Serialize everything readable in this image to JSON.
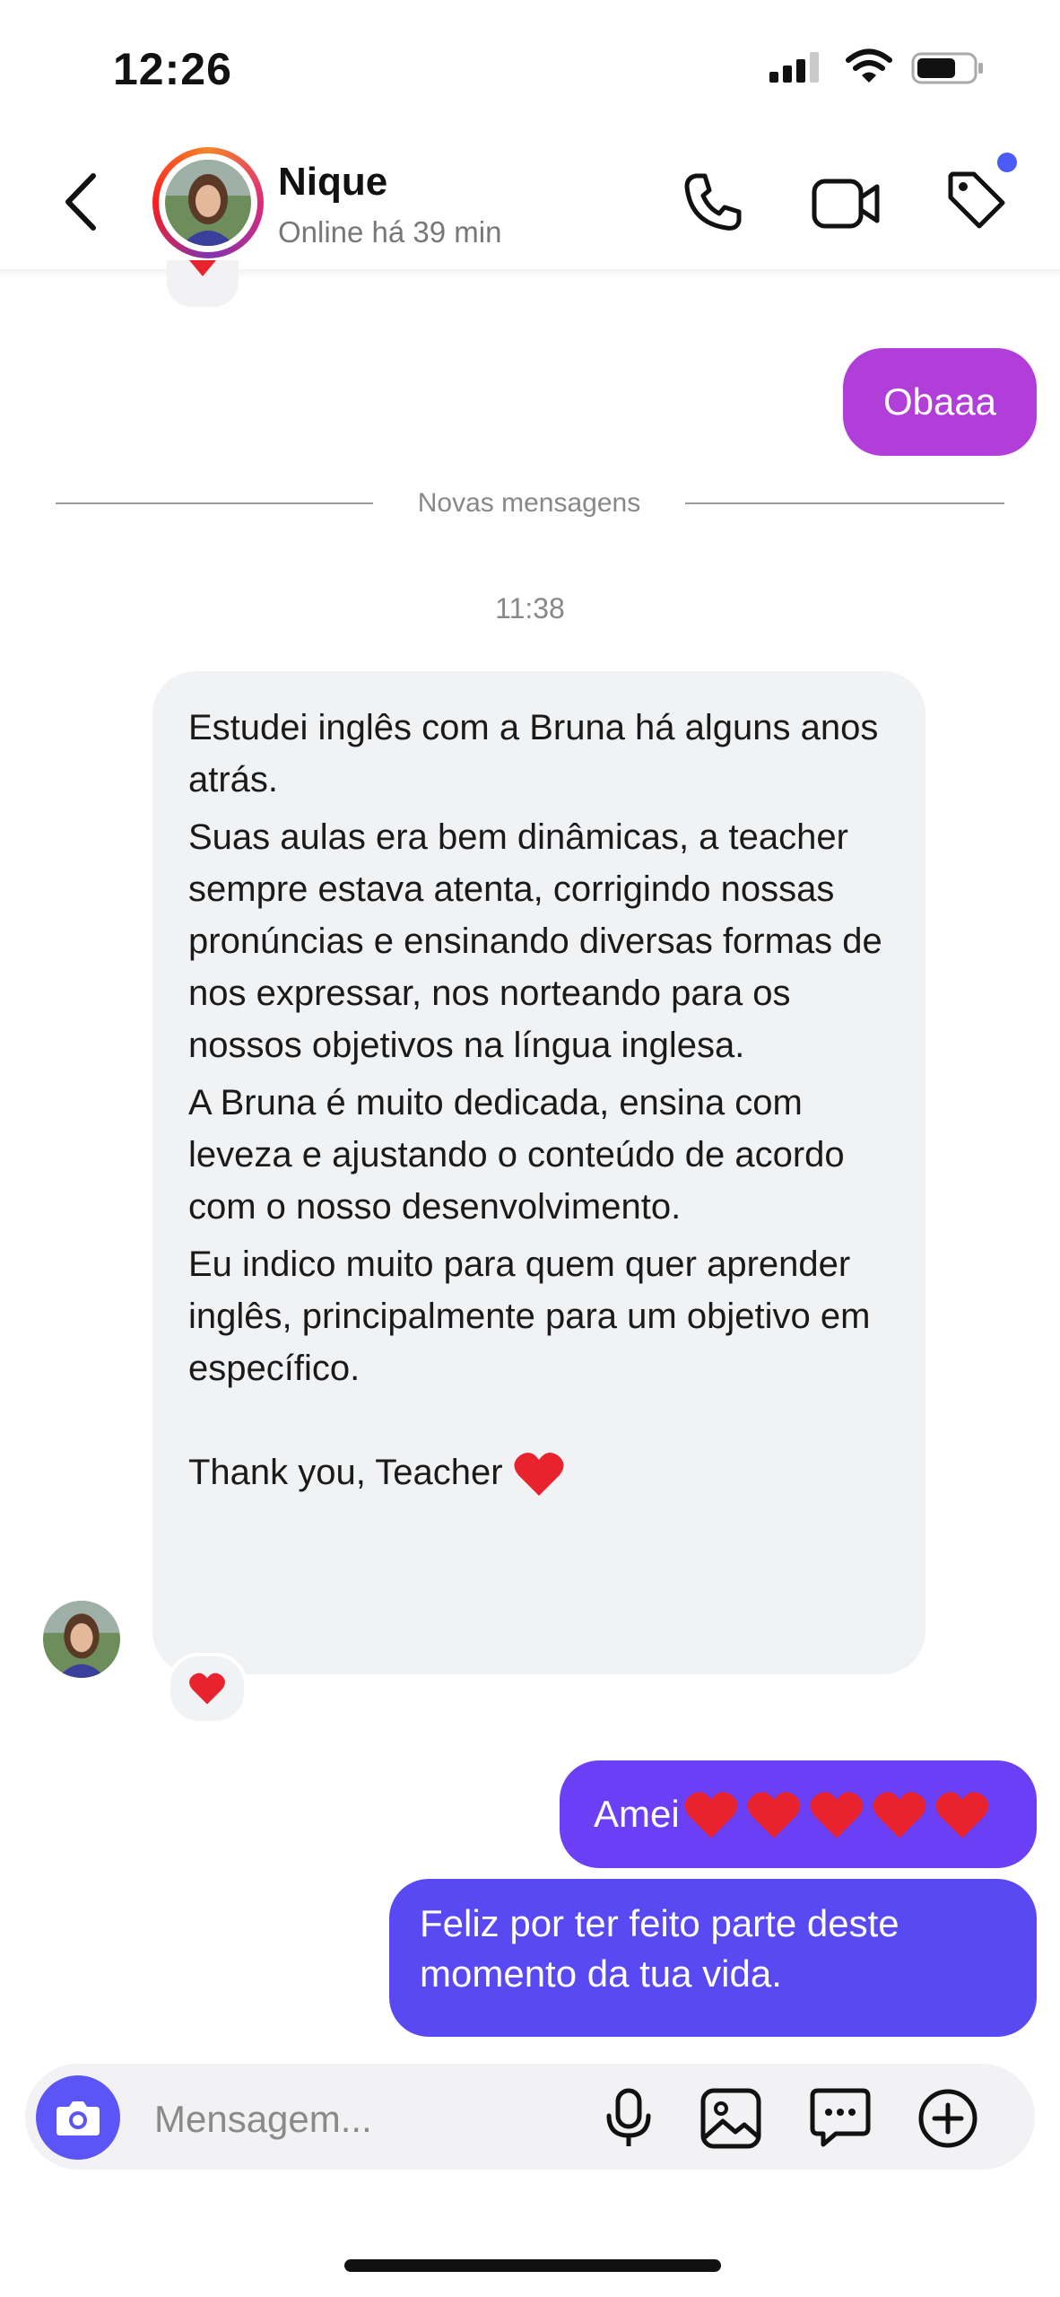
{
  "status_bar": {
    "time": "12:26"
  },
  "header": {
    "contact_name": "Nique",
    "contact_status": "Online há 39 min"
  },
  "thread": {
    "outgoing_top": "Obaaa",
    "separator_label": "Novas mensagens",
    "timestamp": "11:38",
    "incoming_message": {
      "paragraphs": [
        "Estudei inglês com a Bruna há alguns anos atrás.",
        "Suas aulas era bem dinâmicas, a teacher sempre estava atenta, corrigindo nossas pronúncias e ensinando diversas formas de nos expressar, nos norteando para os nossos objetivos na língua inglesa.",
        "A Bruna é muito dedicada, ensina com leveza e ajustando o conteúdo de acordo com o nosso desenvolvimento.",
        "Eu indico muito para quem quer aprender inglês, principalmente para um objetivo em específico."
      ],
      "closing": "Thank you, Teacher",
      "reaction": "red-heart"
    },
    "outgoing_amei": "Amei",
    "outgoing_amei_heart_count": 5,
    "outgoing_feliz": "Feliz por ter feito parte deste momento da tua vida."
  },
  "composer": {
    "placeholder": "Mensagem..."
  },
  "colors": {
    "accent_purple": "#b13ed8",
    "accent_violet": "#6a3ff5",
    "accent_blue": "#5949f3",
    "camera_button": "#5b54f6",
    "heart_red": "#e8232e"
  }
}
